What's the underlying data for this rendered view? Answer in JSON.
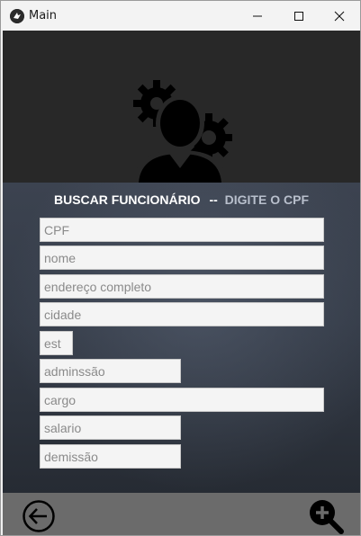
{
  "window": {
    "title": "Main",
    "controls": [
      "minimize",
      "maximize",
      "close"
    ]
  },
  "header": {
    "logo_icon": "employee-settings-icon"
  },
  "search": {
    "title": "BUSCAR FUNCIONÁRIO",
    "separator": "--",
    "hint": "DIGITE O CPF"
  },
  "form": {
    "cpf_placeholder": "CPF",
    "nome_placeholder": "nome",
    "endereco_placeholder": "endereço completo",
    "cidade_placeholder": "cidade",
    "estado_placeholder": "est",
    "admissao_placeholder": "adminssão",
    "cargo_placeholder": "cargo",
    "salario_placeholder": "salario",
    "demissao_placeholder": "demissão"
  },
  "footer": {
    "back_icon": "arrow-left-circle-icon",
    "search_icon": "zoom-in-icon"
  },
  "colors": {
    "header_bg": "#282828",
    "body_bg": "#343b47",
    "footer_bg": "#6b6b6b",
    "hint_text": "#b8bfcc"
  }
}
